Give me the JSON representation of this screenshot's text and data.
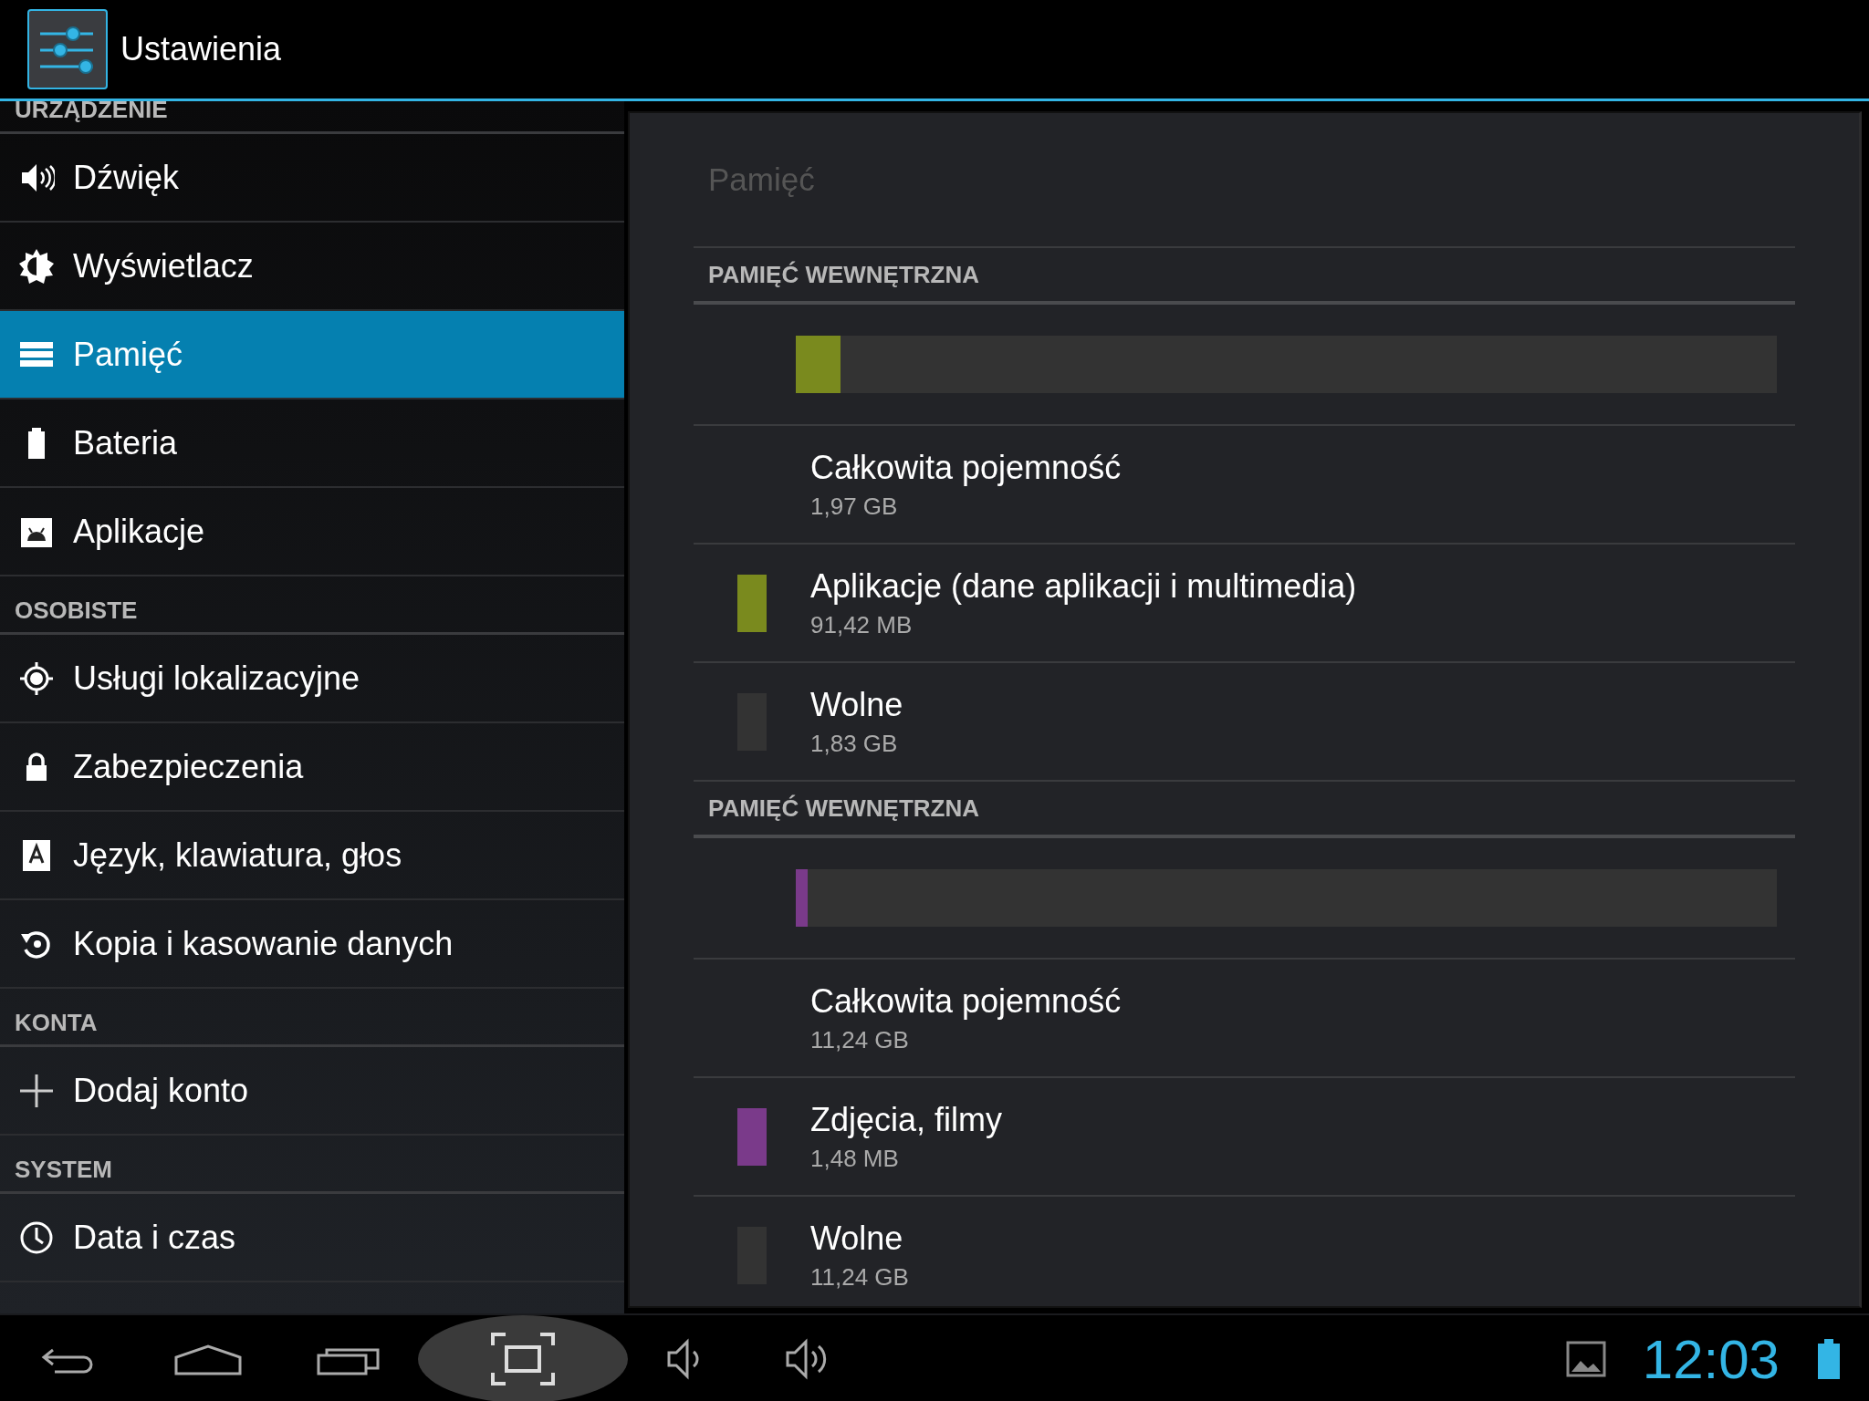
{
  "action_bar": {
    "title": "Ustawienia"
  },
  "sidebar": {
    "sections": [
      {
        "header": "URZĄDZENIE",
        "items": [
          {
            "label": "Dźwięk",
            "selected": false
          },
          {
            "label": "Wyświetlacz",
            "selected": false
          },
          {
            "label": "Pamięć",
            "selected": true
          },
          {
            "label": "Bateria",
            "selected": false
          },
          {
            "label": "Aplikacje",
            "selected": false
          }
        ]
      },
      {
        "header": "OSOBISTE",
        "items": [
          {
            "label": "Usługi lokalizacyjne",
            "selected": false
          },
          {
            "label": "Zabezpieczenia",
            "selected": false
          },
          {
            "label": "Język, klawiatura, głos",
            "selected": false
          },
          {
            "label": "Kopia i kasowanie danych",
            "selected": false
          }
        ]
      },
      {
        "header": "KONTA",
        "items": [
          {
            "label": "Dodaj konto",
            "selected": false
          }
        ]
      },
      {
        "header": "SYSTEM",
        "items": [
          {
            "label": "Data i czas",
            "selected": false
          }
        ]
      }
    ]
  },
  "panel": {
    "title": "Pamięć",
    "sections": [
      {
        "header": "PAMIĘĆ WEWNĘTRZNA",
        "bar": {
          "level": 0.046,
          "color": "#7a8a1e"
        },
        "items": [
          {
            "title": "Całkowita pojemność",
            "value": "1,97 GB"
          },
          {
            "title": "Aplikacje (dane aplikacji i multimedia)",
            "value": "91,42 MB",
            "color": "#7a8a1e"
          },
          {
            "title": "Wolne",
            "value": "1,83 GB",
            "color": "#333333"
          }
        ]
      },
      {
        "header": "PAMIĘĆ WEWNĘTRZNA",
        "bar": {
          "level": 0.012,
          "color": "#7a3a8a"
        },
        "items": [
          {
            "title": "Całkowita pojemność",
            "value": "11,24 GB"
          },
          {
            "title": "Zdjęcia, filmy",
            "value": "1,48 MB",
            "color": "#7a3a8a"
          },
          {
            "title": "Wolne",
            "value": "11,24 GB",
            "color": "#333333"
          }
        ]
      }
    ]
  },
  "nav_bar": {
    "buttons": [
      {
        "kind": "back",
        "pressed": false
      },
      {
        "kind": "home",
        "pressed": false
      },
      {
        "kind": "recents",
        "pressed": false
      },
      {
        "kind": "screenshot",
        "pressed": true
      },
      {
        "kind": "volume_down",
        "pressed": false
      },
      {
        "kind": "volume_up",
        "pressed": false
      }
    ],
    "clock": "12:03"
  }
}
